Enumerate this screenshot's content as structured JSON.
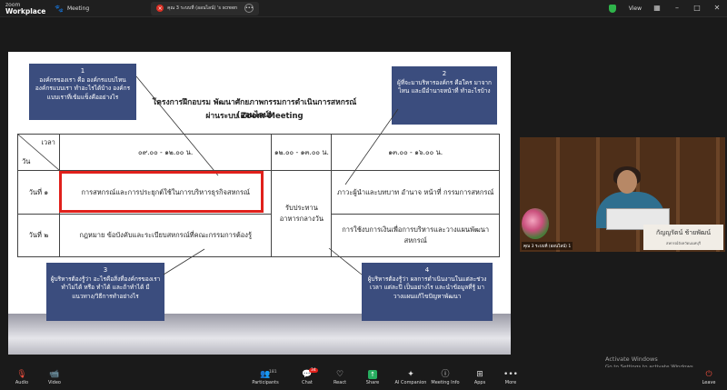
{
  "titlebar": {
    "brand_small": "zoom",
    "brand_main": "Workplace",
    "app_tab": "Meeting",
    "share_tab": "คุณ 3 ระบบที่ (ออนไลน์) 's screen",
    "view_label": "View"
  },
  "slide": {
    "title_line1": "โครงการฝึกอบรม พัฒนาศักยภาพกรรมการดำเนินการสหกรณ์ (ออนไลน์)",
    "title_line2": "ผ่านระบบ Zoom Meeting",
    "callouts": [
      {
        "num": "1",
        "text": "องค์กรของเรา คือ องค์กรแบบไหน องค์กรแบบเรา ทำอะไรได้บ้าง องค์กรแบบเราที่เข้มแข็งคืออย่างไร"
      },
      {
        "num": "2",
        "text": "ผู้ที่จะมาบริหารองค์กร คือใคร มาจากไหน และมีอำนาจหน้าที่ ทำอะไรบ้าง"
      },
      {
        "num": "3",
        "text": "ผู้บริหารต้องรู้ว่า อะไรคือสิ่งที่องค์กรของเรา ทำไม่ได้ หรือ ทำได้ และถ้าทำได้ มีแนวทาง/วิธีการทำอย่างไร"
      },
      {
        "num": "4",
        "text": "ผู้บริหารต้องรู้ว่า ผลการดำเนินงานในแต่ละช่วงเวลา แต่ละปี เป็นอย่างไร และนำข้อมูลที่รู้ มาวางแผนแก้ไขปัญหาพัฒนา"
      }
    ],
    "table": {
      "corner_time": "เวลา",
      "corner_day": "วัน",
      "times": [
        "๐๙.๐๐ - ๑๒.๐๐ น.",
        "๑๒.๐๐ - ๑๓.๐๐ น.",
        "๑๓.๐๐ - ๑๖.๐๐ น."
      ],
      "rows": [
        {
          "day": "วันที่ ๑",
          "morning": "การสหกรณ์และการประยุกต์ใช้ในการบริหารธุรกิจสหกรณ์",
          "afternoon": "ภาวะผู้นำและบทบาท อำนาจ หน้าที่ กรรมการสหกรณ์"
        },
        {
          "day": "วันที่ ๒",
          "morning": "กฎหมาย ข้อบังคับและระเบียบสหกรณ์ที่คณะกรรมการต้องรู้",
          "afternoon": "การใช้งบการเงินเพื่อการบริหารและวางแผนพัฒนาสหกรณ์"
        }
      ],
      "lunch": "รับประทานอาหารกลางวัน"
    }
  },
  "video": {
    "name": "กัญญรัตน์ ช้ายพัฒน์",
    "sub": "สหกรณ์จังหวัดนนทบุรี",
    "label": "คุณ 3 ระบบที่ (ออนไลน์) 1"
  },
  "windows_notice": {
    "line1": "Activate Windows",
    "line2": "Go to Settings to activate Windows."
  },
  "toolbar": {
    "audio": "Audio",
    "video": "Video",
    "participants": "Participants",
    "participants_count": "181",
    "chat": "Chat",
    "chat_badge": "34",
    "react": "React",
    "share": "Share",
    "ai_companion": "AI Companion",
    "meeting_info": "Meeting Info",
    "apps": "Apps",
    "more": "More",
    "leave": "Leave"
  }
}
